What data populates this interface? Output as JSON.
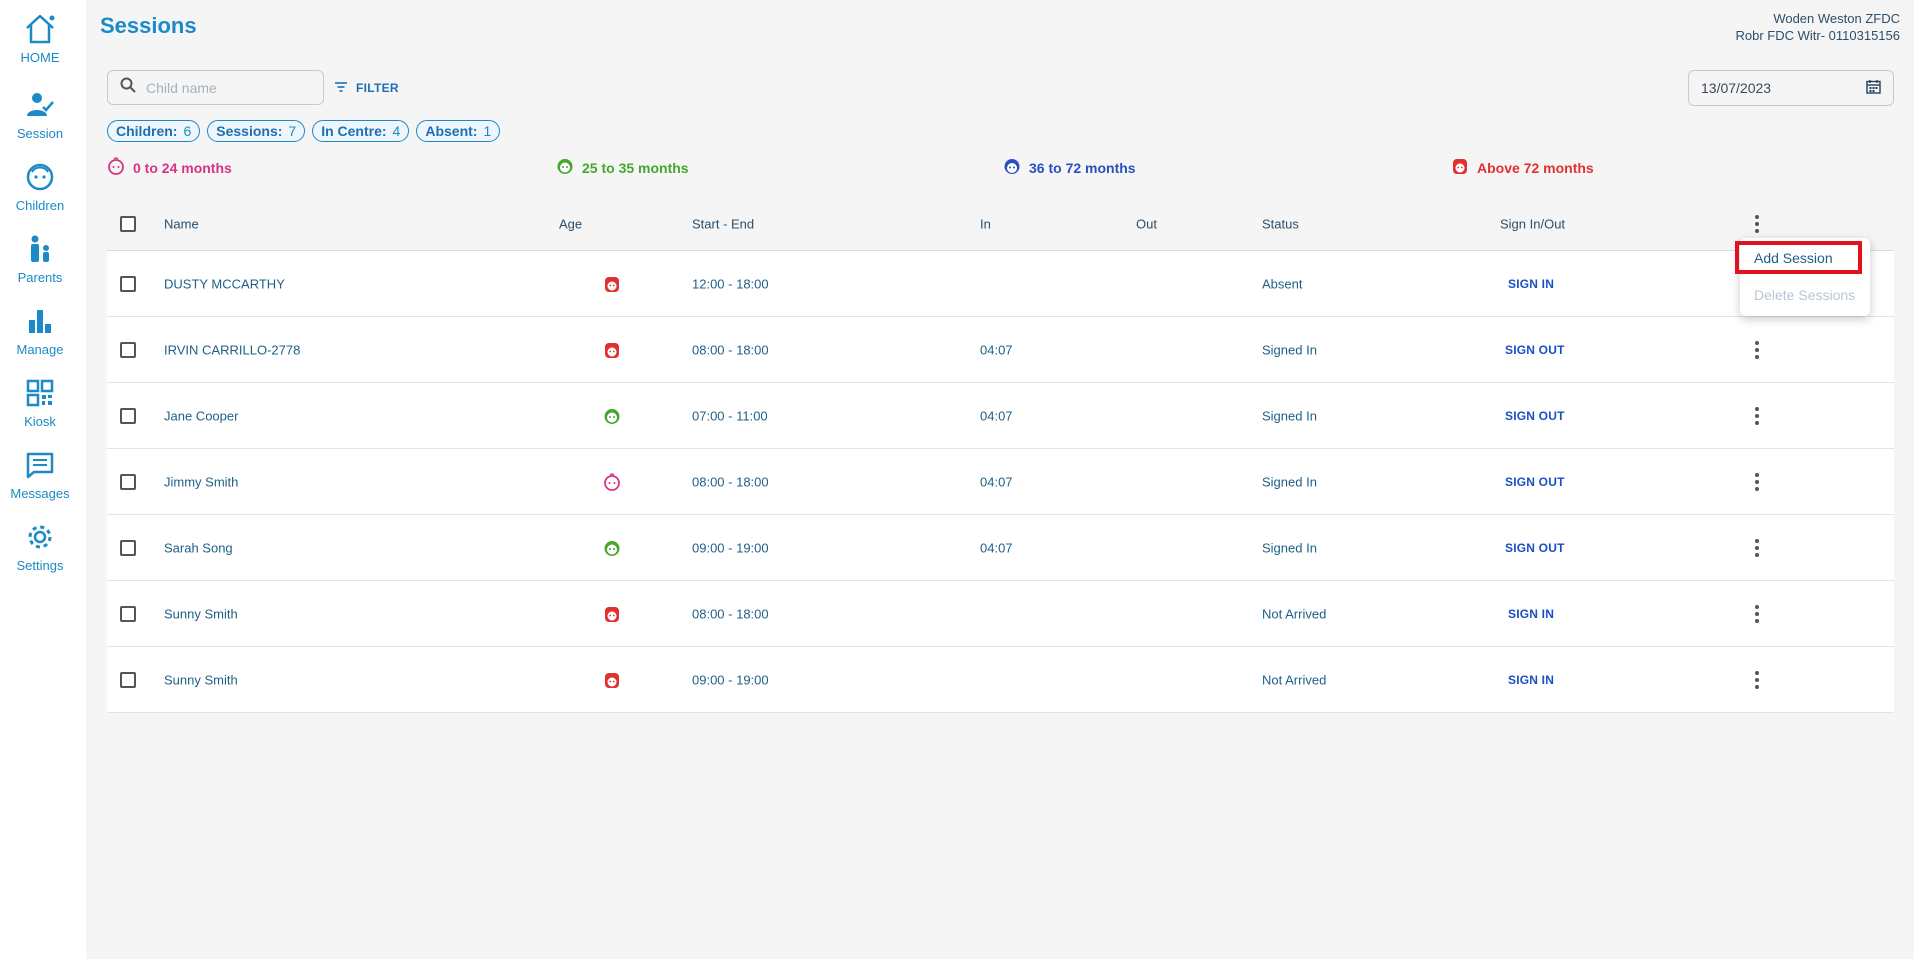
{
  "nav": [
    {
      "label": "HOME",
      "icon": "home-icon"
    },
    {
      "label": "Session",
      "icon": "session-icon"
    },
    {
      "label": "Children",
      "icon": "children-icon"
    },
    {
      "label": "Parents",
      "icon": "parents-icon"
    },
    {
      "label": "Manage",
      "icon": "bar-chart-icon"
    },
    {
      "label": "Kiosk",
      "icon": "qr-code-icon"
    },
    {
      "label": "Messages",
      "icon": "message-icon"
    },
    {
      "label": "Settings",
      "icon": "gear-icon"
    }
  ],
  "header": {
    "title": "Sessions",
    "org_line1": "Woden Weston ZFDC",
    "org_line2": "Robr FDC Witr- 0110315156"
  },
  "search": {
    "placeholder": "Child name",
    "value": ""
  },
  "filter_label": "FILTER",
  "date": "13/07/2023",
  "chips": [
    {
      "label": "Children:",
      "value": "6"
    },
    {
      "label": "Sessions:",
      "value": "7"
    },
    {
      "label": "In Centre:",
      "value": "4"
    },
    {
      "label": "Absent:",
      "value": "1"
    }
  ],
  "legend": [
    {
      "label": "0 to 24 months",
      "color": "#d63384"
    },
    {
      "label": "25 to 35 months",
      "color": "#43a82d"
    },
    {
      "label": "36 to 72 months",
      "color": "#2a4fc2"
    },
    {
      "label": "Above 72 months",
      "color": "#e03131"
    }
  ],
  "columns": {
    "name": "Name",
    "age": "Age",
    "start_end": "Start - End",
    "in": "In",
    "out": "Out",
    "status": "Status",
    "sign": "Sign In/Out"
  },
  "rows": [
    {
      "name": "DUSTY MCCARTHY",
      "age_group": "above-72",
      "start_end": "12:00 - 18:00",
      "in": "",
      "out": "",
      "status": "Absent",
      "action": "SIGN IN"
    },
    {
      "name": "IRVIN CARRILLO-2778",
      "age_group": "above-72",
      "start_end": "08:00 - 18:00",
      "in": "04:07",
      "out": "",
      "status": "Signed In",
      "action": "SIGN OUT"
    },
    {
      "name": "Jane Cooper",
      "age_group": "25-35",
      "start_end": "07:00 - 11:00",
      "in": "04:07",
      "out": "",
      "status": "Signed In",
      "action": "SIGN OUT"
    },
    {
      "name": "Jimmy Smith",
      "age_group": "0-24",
      "start_end": "08:00 - 18:00",
      "in": "04:07",
      "out": "",
      "status": "Signed In",
      "action": "SIGN OUT"
    },
    {
      "name": "Sarah Song",
      "age_group": "25-35",
      "start_end": "09:00 - 19:00",
      "in": "04:07",
      "out": "",
      "status": "Signed In",
      "action": "SIGN OUT"
    },
    {
      "name": "Sunny Smith",
      "age_group": "above-72",
      "start_end": "08:00 - 18:00",
      "in": "",
      "out": "",
      "status": "Not Arrived",
      "action": "SIGN IN"
    },
    {
      "name": "Sunny Smith",
      "age_group": "above-72",
      "start_end": "09:00 - 19:00",
      "in": "",
      "out": "",
      "status": "Not Arrived",
      "action": "SIGN IN"
    }
  ],
  "menu": {
    "add": "Add Session",
    "delete": "Delete Sessions"
  },
  "colors": {
    "accent": "#1b8ac6",
    "highlight": "#e0121f"
  }
}
